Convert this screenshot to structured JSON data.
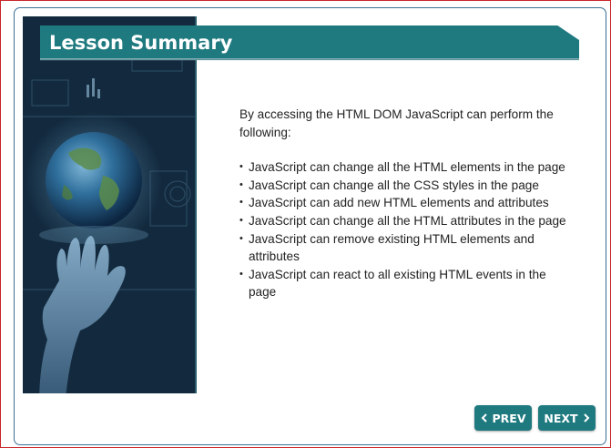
{
  "title": "Lesson Summary",
  "intro": "By accessing the HTML DOM JavaScript can perform the following:",
  "bullets": [
    "JavaScript can change all the HTML elements in the page",
    "JavaScript can change all the CSS styles in the page",
    "JavaScript can add new HTML elements and attributes",
    "JavaScript can change all the HTML attributes in the page",
    "JavaScript can remove existing HTML elements and attributes",
    "JavaScript can react to all existing HTML events in the page"
  ],
  "navigation": {
    "prev_label": "PREV",
    "next_label": "NEXT",
    "prev_icon": "chevron-left-icon",
    "next_icon": "chevron-right-icon"
  },
  "colors": {
    "accent": "#1f7a80",
    "frame_border": "#c9262c",
    "card_border": "#3a6f95"
  }
}
